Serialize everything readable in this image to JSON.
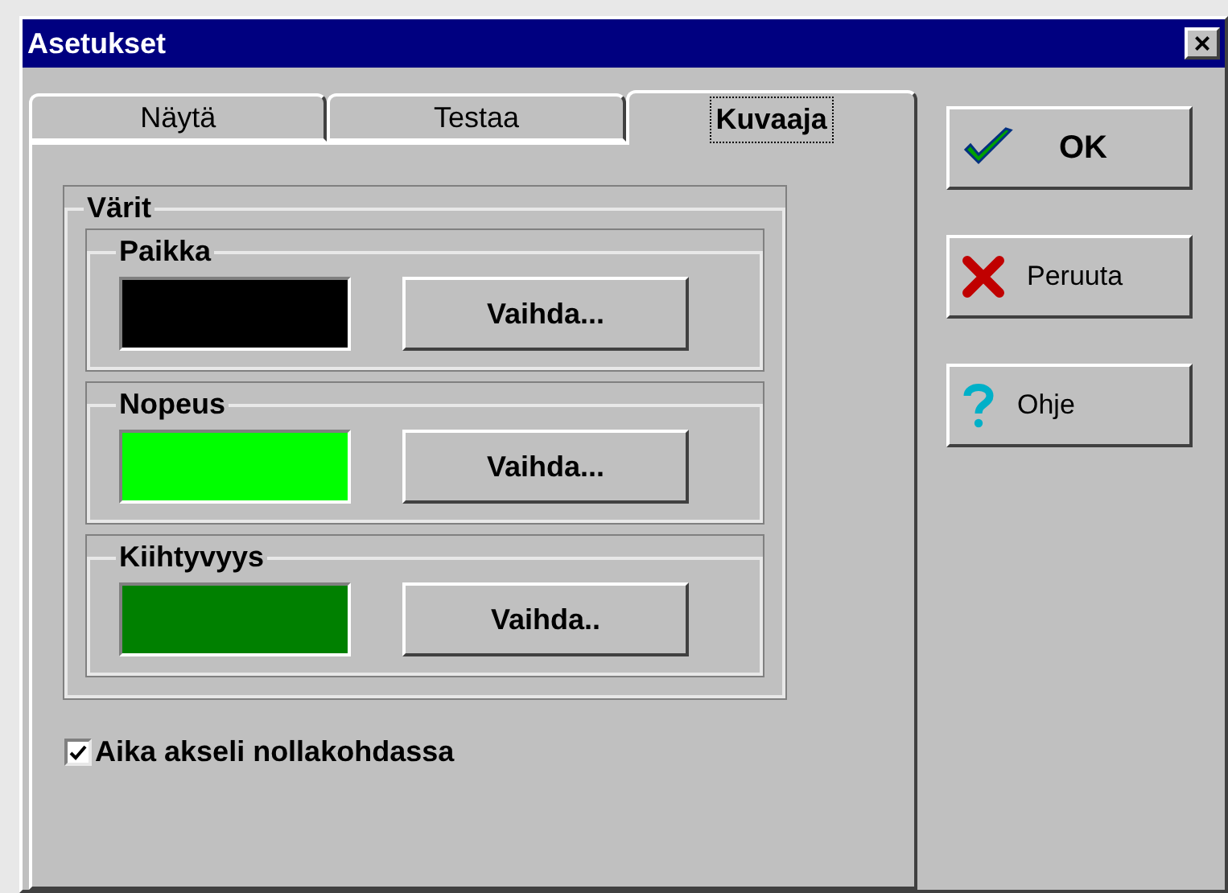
{
  "window": {
    "title": "Asetukset",
    "close": "×"
  },
  "tabs": [
    {
      "label": "Näytä",
      "selected": false
    },
    {
      "label": "Testaa",
      "selected": false
    },
    {
      "label": "Kuvaaja",
      "selected": true
    }
  ],
  "colors_group": {
    "title": "Värit",
    "items": [
      {
        "title": "Paikka",
        "color": "#000000",
        "button": "Vaihda..."
      },
      {
        "title": "Nopeus",
        "color": "#00ff00",
        "button": "Vaihda..."
      },
      {
        "title": "Kiihtyvyys",
        "color": "#008000",
        "button": "Vaihda.."
      }
    ]
  },
  "checkbox": {
    "label": "Aika akseli nollakohdassa",
    "checked": true
  },
  "buttons": [
    {
      "kind": "ok",
      "label": "OK"
    },
    {
      "kind": "cancel",
      "label": "Peruuta"
    },
    {
      "kind": "help",
      "label": "Ohje"
    }
  ]
}
